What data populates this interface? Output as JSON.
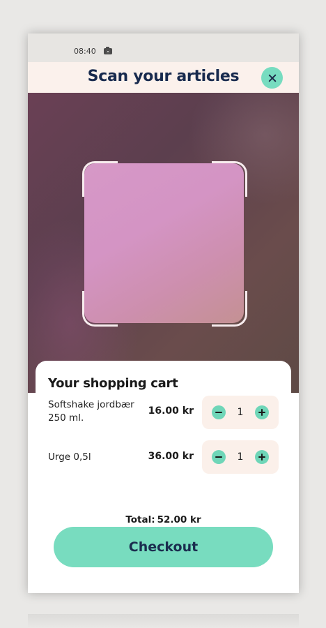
{
  "status_bar": {
    "time": "08:40",
    "icon": "camera-icon"
  },
  "header": {
    "title": "Scan your articles",
    "close_icon": "close-icon"
  },
  "cart": {
    "title": "Your shopping cart",
    "items": [
      {
        "name": "Softshake jordbær 250 ml.",
        "price": "16.00 kr",
        "quantity": "1"
      },
      {
        "name": "Urge 0,5l",
        "price": "36.00 kr",
        "quantity": "1"
      }
    ],
    "total_label": "Total:",
    "total_value": "52.00 kr",
    "checkout_label": "Checkout"
  },
  "colors": {
    "accent": "#78dcbf",
    "header_bg": "#fbf1ec",
    "title_text": "#182a4e"
  }
}
